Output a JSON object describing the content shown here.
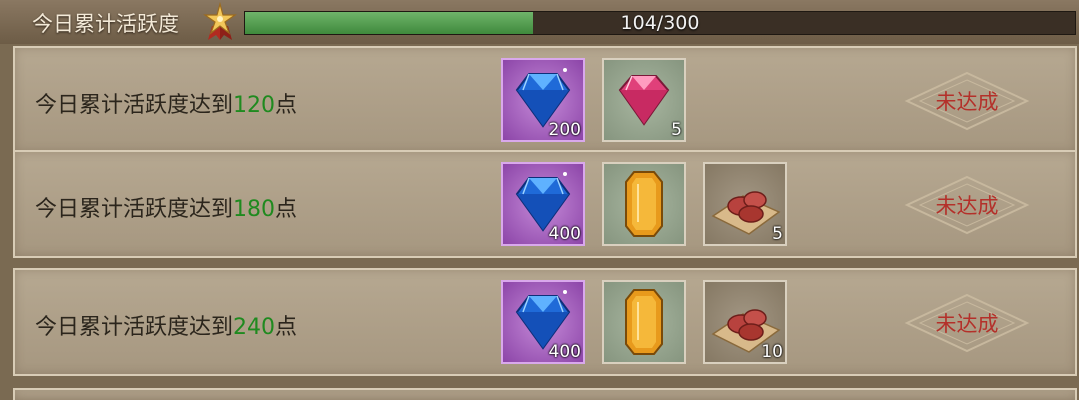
{
  "header": {
    "title": "今日累计活跃度",
    "progress_text": "104/300",
    "progress_value": 104,
    "progress_max": 300
  },
  "rows": [
    {
      "prefix": "今日累计活跃度达到",
      "target": "120",
      "suffix": "点",
      "status": "未达成",
      "rewards": [
        {
          "icon": "blue-diamond-icon",
          "qty": "200"
        },
        {
          "icon": "pink-gem-icon",
          "qty": "5"
        }
      ]
    },
    {
      "prefix": "今日累计活跃度达到",
      "target": "180",
      "suffix": "点",
      "status": "未达成",
      "rewards": [
        {
          "icon": "blue-diamond-icon",
          "qty": "400"
        },
        {
          "icon": "amber-crystal-icon",
          "qty": ""
        },
        {
          "icon": "meat-icon",
          "qty": "5"
        }
      ]
    },
    {
      "prefix": "今日累计活跃度达到",
      "target": "240",
      "suffix": "点",
      "status": "未达成",
      "rewards": [
        {
          "icon": "blue-diamond-icon",
          "qty": "400"
        },
        {
          "icon": "amber-crystal-icon",
          "qty": ""
        },
        {
          "icon": "meat-icon",
          "qty": "10"
        }
      ]
    }
  ],
  "colors": {
    "target_number": "#1f8a1f",
    "status_text": "#b4302a",
    "progress_fill": "#4f9a4a"
  }
}
